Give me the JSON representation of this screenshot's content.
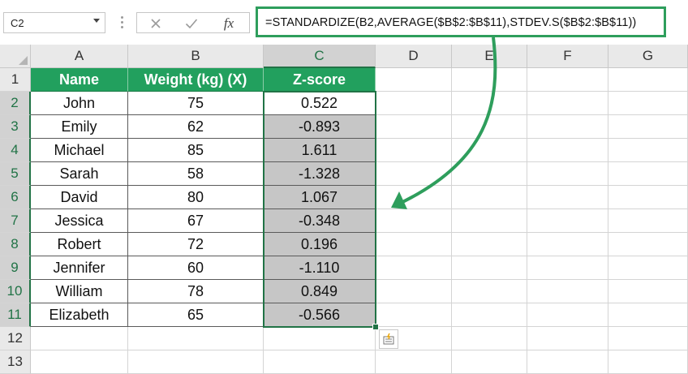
{
  "formula_bar": {
    "name_box": "C2",
    "formula": "=STANDARDIZE(B2,AVERAGE($B$2:$B$11),STDEV.S($B$2:$B$11))",
    "cancel_icon": "close-icon",
    "enter_icon": "check-icon",
    "function_label": "fx"
  },
  "columns": [
    "A",
    "B",
    "C",
    "D",
    "E",
    "F",
    "G"
  ],
  "rows": [
    "1",
    "2",
    "3",
    "4",
    "5",
    "6",
    "7",
    "8",
    "9",
    "10",
    "11",
    "12",
    "13"
  ],
  "table": {
    "headers": [
      "Name",
      "Weight (kg) (X)",
      "Z-score"
    ],
    "rows": [
      {
        "name": "John",
        "weight": "75",
        "z": "0.522"
      },
      {
        "name": "Emily",
        "weight": "62",
        "z": "-0.893"
      },
      {
        "name": "Michael",
        "weight": "85",
        "z": "1.611"
      },
      {
        "name": "Sarah",
        "weight": "58",
        "z": "-1.328"
      },
      {
        "name": "David",
        "weight": "80",
        "z": "1.067"
      },
      {
        "name": "Jessica",
        "weight": "67",
        "z": "-0.348"
      },
      {
        "name": "Robert",
        "weight": "72",
        "z": "0.196"
      },
      {
        "name": "Jennifer",
        "weight": "60",
        "z": "-1.110"
      },
      {
        "name": "William",
        "weight": "78",
        "z": "0.849"
      },
      {
        "name": "Elizabeth",
        "weight": "65",
        "z": "-0.566"
      }
    ]
  },
  "selected_column": "C",
  "colors": {
    "header_fill": "#22a05e",
    "annotation": "#2e9e5c",
    "selection": "#217346",
    "zscore_fill": "#c6c6c6"
  }
}
